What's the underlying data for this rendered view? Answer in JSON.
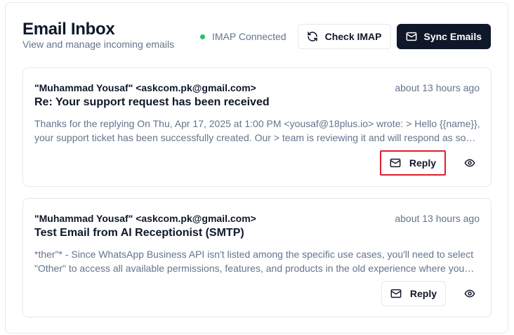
{
  "header": {
    "title": "Email Inbox",
    "subtitle": "View and manage incoming emails",
    "status_text": "IMAP Connected",
    "status_color": "#22c55e",
    "check_button_label": "Check IMAP",
    "sync_button_label": "Sync Emails"
  },
  "emails": [
    {
      "sender": "\"Muhammad Yousaf\" <askcom.pk@gmail.com>",
      "time": "about 13 hours ago",
      "subject": "Re: Your support request has been received",
      "preview": "Thanks for the replying On Thu, Apr 17, 2025 at 1:00 PM <yousaf@18plus.io> wrote: > Hello {{name}}, your support ticket has been successfully created. Our > team is reviewing it and will respond as soon as possible.",
      "reply_label": "Reply",
      "highlighted": true
    },
    {
      "sender": "\"Muhammad Yousaf\" <askcom.pk@gmail.com>",
      "time": "about 13 hours ago",
      "subject": "Test Email from AI Receptionist (SMTP)",
      "preview": "*ther\"* - Since WhatsApp Business API isn't listed among the specific use cases, you'll need to select \"Other\" to access all available permissions, features, and products in the old experience where you can choose.",
      "reply_label": "Reply",
      "highlighted": false
    }
  ],
  "icons": {
    "refresh": "refresh-icon",
    "mail": "mail-icon",
    "eye": "eye-icon"
  },
  "colors": {
    "primary_dark": "#0f172a",
    "muted_text": "#64748b",
    "border": "#e2e8f0",
    "highlight": "#e11d2b"
  }
}
